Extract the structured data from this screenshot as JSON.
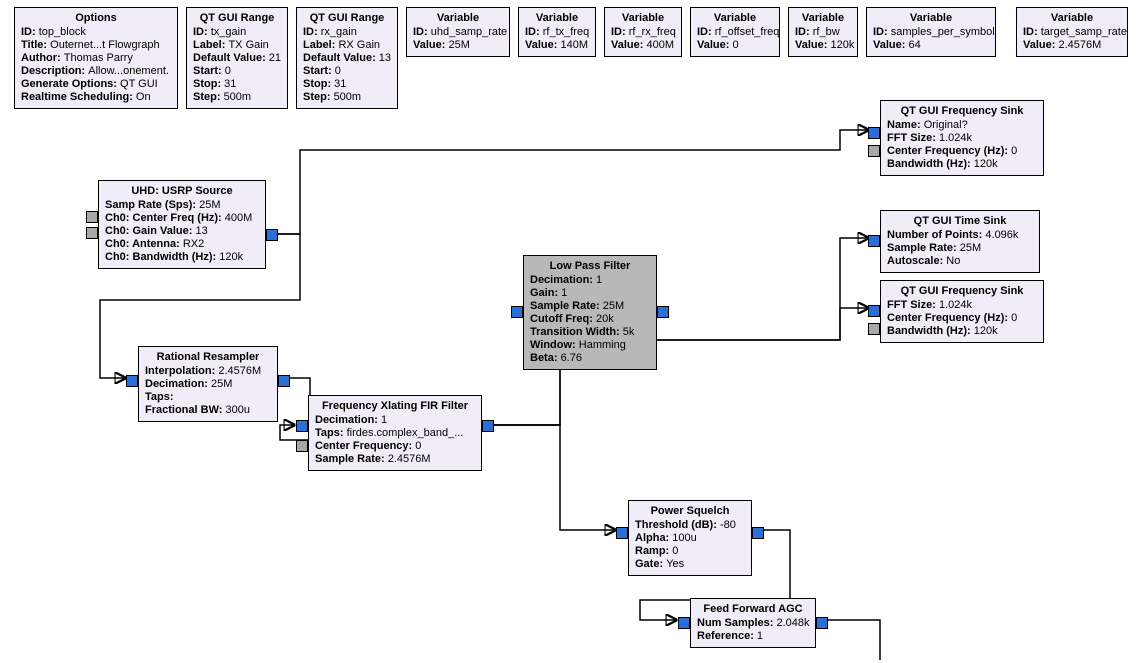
{
  "blocks": {
    "options": {
      "title": "Options",
      "rows": [
        [
          "ID:",
          "top_block"
        ],
        [
          "Title:",
          "Outernet...t Flowgraph"
        ],
        [
          "Author:",
          "Thomas Parry"
        ],
        [
          "Description:",
          "Allow...onement."
        ],
        [
          "Generate Options:",
          "QT GUI"
        ],
        [
          "Realtime Scheduling:",
          "On"
        ]
      ]
    },
    "qt_range_tx": {
      "title": "QT GUI Range",
      "rows": [
        [
          "ID:",
          "tx_gain"
        ],
        [
          "Label:",
          "TX Gain"
        ],
        [
          "Default Value:",
          "21"
        ],
        [
          "Start:",
          "0"
        ],
        [
          "Stop:",
          "31"
        ],
        [
          "Step:",
          "500m"
        ]
      ]
    },
    "qt_range_rx": {
      "title": "QT GUI Range",
      "rows": [
        [
          "ID:",
          "rx_gain"
        ],
        [
          "Label:",
          "RX Gain"
        ],
        [
          "Default Value:",
          "13"
        ],
        [
          "Start:",
          "0"
        ],
        [
          "Stop:",
          "31"
        ],
        [
          "Step:",
          "500m"
        ]
      ]
    },
    "var_uhd_samp_rate": {
      "title": "Variable",
      "rows": [
        [
          "ID:",
          "uhd_samp_rate"
        ],
        [
          "Value:",
          "25M"
        ]
      ]
    },
    "var_rf_tx_freq": {
      "title": "Variable",
      "rows": [
        [
          "ID:",
          "rf_tx_freq"
        ],
        [
          "Value:",
          "140M"
        ]
      ]
    },
    "var_rf_rx_freq": {
      "title": "Variable",
      "rows": [
        [
          "ID:",
          "rf_rx_freq"
        ],
        [
          "Value:",
          "400M"
        ]
      ]
    },
    "var_rf_offset": {
      "title": "Variable",
      "rows": [
        [
          "ID:",
          "rf_offset_freq"
        ],
        [
          "Value:",
          "0"
        ]
      ]
    },
    "var_rf_bw": {
      "title": "Variable",
      "rows": [
        [
          "ID:",
          "rf_bw"
        ],
        [
          "Value:",
          "120k"
        ]
      ]
    },
    "var_sps": {
      "title": "Variable",
      "rows": [
        [
          "ID:",
          "samples_per_symbol"
        ],
        [
          "Value:",
          "64"
        ]
      ]
    },
    "var_target_rate": {
      "title": "Variable",
      "rows": [
        [
          "ID:",
          "target_samp_rate"
        ],
        [
          "Value:",
          "2.4576M"
        ]
      ]
    },
    "usrp_source": {
      "title": "UHD: USRP Source",
      "rows": [
        [
          "Samp Rate (Sps):",
          "25M"
        ],
        [
          "Ch0: Center Freq (Hz):",
          "400M"
        ],
        [
          "Ch0: Gain Value:",
          "13"
        ],
        [
          "Ch0: Antenna:",
          "RX2"
        ],
        [
          "Ch0: Bandwidth (Hz):",
          "120k"
        ]
      ]
    },
    "rational_resampler": {
      "title": "Rational Resampler",
      "rows": [
        [
          "Interpolation:",
          "2.4576M"
        ],
        [
          "Decimation:",
          "25M"
        ],
        [
          "Taps:",
          ""
        ],
        [
          "Fractional BW:",
          "300u"
        ]
      ]
    },
    "low_pass_filter": {
      "title": "Low Pass Filter",
      "rows": [
        [
          "Decimation:",
          "1"
        ],
        [
          "Gain:",
          "1"
        ],
        [
          "Sample Rate:",
          "25M"
        ],
        [
          "Cutoff Freq:",
          "20k"
        ],
        [
          "Transition Width:",
          "5k"
        ],
        [
          "Window:",
          "Hamming"
        ],
        [
          "Beta:",
          "6.76"
        ]
      ]
    },
    "freq_xlating": {
      "title": "Frequency Xlating FIR Filter",
      "rows": [
        [
          "Decimation:",
          "1"
        ],
        [
          "Taps:",
          "firdes.complex_band_..."
        ],
        [
          "Center Frequency:",
          "0"
        ],
        [
          "Sample Rate:",
          "2.4576M"
        ]
      ]
    },
    "power_squelch": {
      "title": "Power Squelch",
      "rows": [
        [
          "Threshold (dB):",
          "-80"
        ],
        [
          "Alpha:",
          "100u"
        ],
        [
          "Ramp:",
          "0"
        ],
        [
          "Gate:",
          "Yes"
        ]
      ]
    },
    "ff_agc": {
      "title": "Feed Forward AGC",
      "rows": [
        [
          "Num Samples:",
          "2.048k"
        ],
        [
          "Reference:",
          "1"
        ]
      ]
    },
    "freq_sink_1": {
      "title": "QT GUI Frequency Sink",
      "rows": [
        [
          "Name:",
          "Original?"
        ],
        [
          "FFT Size:",
          "1.024k"
        ],
        [
          "Center Frequency (Hz):",
          "0"
        ],
        [
          "Bandwidth (Hz):",
          "120k"
        ]
      ]
    },
    "time_sink": {
      "title": "QT GUI Time Sink",
      "rows": [
        [
          "Number of Points:",
          "4.096k"
        ],
        [
          "Sample Rate:",
          "25M"
        ],
        [
          "Autoscale:",
          "No"
        ]
      ]
    },
    "freq_sink_2": {
      "title": "QT GUI Frequency Sink",
      "rows": [
        [
          "FFT Size:",
          "1.024k"
        ],
        [
          "Center Frequency (Hz):",
          "0"
        ],
        [
          "Bandwidth (Hz):",
          "120k"
        ]
      ]
    }
  }
}
